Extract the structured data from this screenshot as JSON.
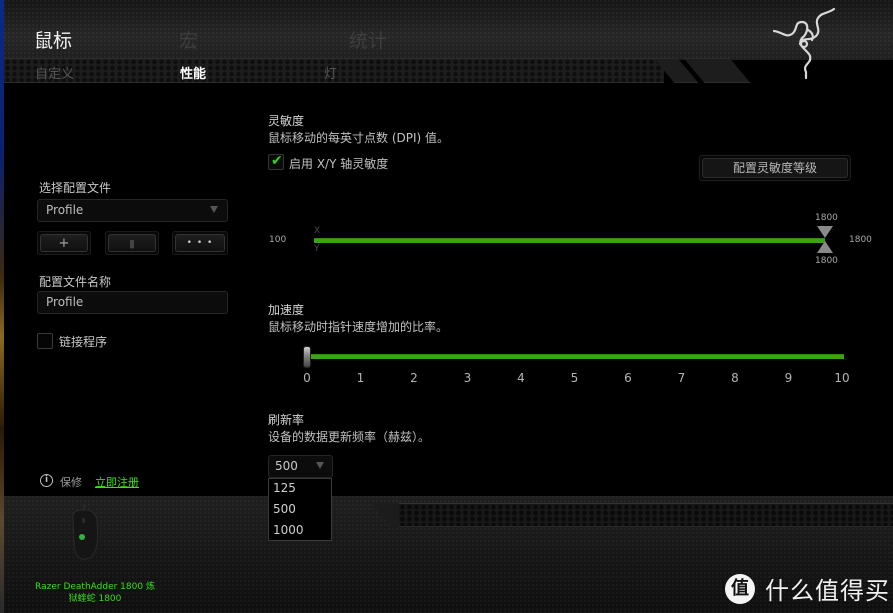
{
  "app": {
    "main_tabs": [
      {
        "label": "鼠标",
        "active": true
      },
      {
        "label": "宏",
        "active": false
      },
      {
        "label": "统计",
        "active": false
      }
    ],
    "sub_tabs": [
      {
        "label": "自定义",
        "active": false
      },
      {
        "label": "性能",
        "active": true
      },
      {
        "label": "灯",
        "active": false
      }
    ],
    "logo": "razer-logo-icon"
  },
  "left_panel": {
    "select_profile_label": "选择配置文件",
    "profile_select_value": "Profile",
    "buttons": [
      {
        "name": "add-profile-button",
        "icon": "plus-icon",
        "glyph": "+"
      },
      {
        "name": "delete-profile-button",
        "icon": "trash-icon",
        "glyph": "▮"
      },
      {
        "name": "more-options-button",
        "icon": "ellipsis-icon",
        "glyph": "• • •"
      }
    ],
    "profile_name_label": "配置文件名称",
    "profile_name_value": "Profile",
    "link_program_label": "链接程序",
    "link_program_checked": false,
    "warranty_label": "保修",
    "register_link": "立即注册",
    "device_name_line1": "Razer DeathAdder 1800 炼",
    "device_name_line2": "狱蝰蛇 1800"
  },
  "sensitivity": {
    "title": "灵敏度",
    "description": "鼠标移动的每英寸点数 (DPI) 值。",
    "enable_xy_label": "启用 X/Y 轴灵敏度",
    "enable_xy_checked": true,
    "config_levels_button": "配置灵敏度等级",
    "min_label": "100",
    "max_label": "1800",
    "x_axis_letter": "X",
    "y_axis_letter": "Y",
    "x_value": "1800",
    "y_value": "1800",
    "x_value_fraction": 1.0,
    "y_value_fraction": 1.0
  },
  "acceleration": {
    "title": "加速度",
    "description": "鼠标移动时指针速度增加的比率。",
    "value": 0,
    "ticks": [
      "0",
      "1",
      "2",
      "3",
      "4",
      "5",
      "6",
      "7",
      "8",
      "9",
      "10"
    ]
  },
  "polling_rate": {
    "title": "刷新率",
    "description": "设备的数据更新频率（赫兹）。",
    "selected": "500",
    "options": [
      "125",
      "500",
      "1000"
    ]
  },
  "watermark": {
    "badge": "值",
    "text": "什么值得买"
  },
  "colors": {
    "accent_green": "#3aa412",
    "link_green": "#3be21a"
  }
}
